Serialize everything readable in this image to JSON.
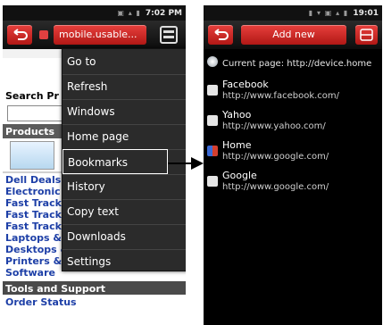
{
  "left_phone": {
    "status_time": "7:02 PM",
    "url": "mobile.usable...",
    "page_partial_texts": {
      "search_heading": "Search Pr",
      "products_heading": "Products"
    },
    "page_links": [
      "Dell Deals",
      "Electronic",
      "Fast Track",
      "Fast Track",
      "Fast Track",
      "Laptops &",
      "Desktops &",
      "Printers & Ink",
      "Software"
    ],
    "tools_heading": "Tools and Support",
    "order_status": "Order Status",
    "menu": [
      "Go to",
      "Refresh",
      "Windows",
      "Home page",
      "Bookmarks",
      "History",
      "Copy text",
      "Downloads",
      "Settings"
    ]
  },
  "right_phone": {
    "status_time": "19:01",
    "add_new_label": "Add new",
    "current_page": "Current page: http://device.home",
    "bookmarks": [
      {
        "title": "Facebook",
        "url": "http://www.facebook.com/",
        "icon": "page-icon"
      },
      {
        "title": "Yahoo",
        "url": "http://www.yahoo.com/",
        "icon": "page-icon"
      },
      {
        "title": "Home",
        "url": "http://www.google.com/",
        "icon": "google-icon"
      },
      {
        "title": "Google",
        "url": "http://www.google.com/",
        "icon": "page-icon"
      }
    ]
  },
  "colors": {
    "accent_red": "#d62b28",
    "link_blue": "#1d3fa7",
    "menu_bg": "#2b2b2b"
  }
}
